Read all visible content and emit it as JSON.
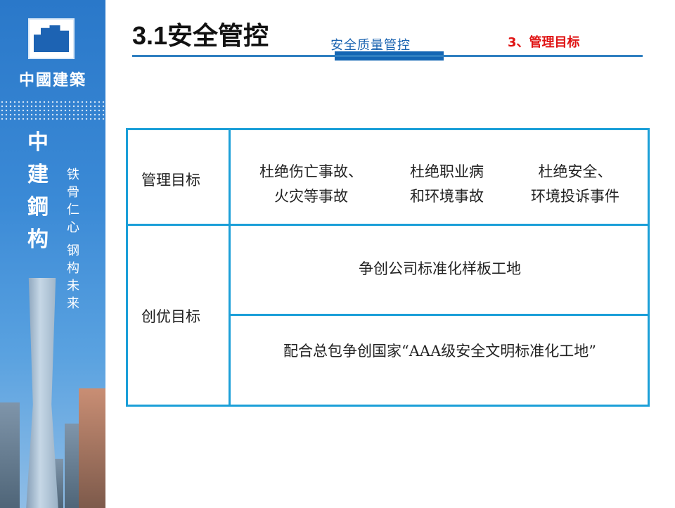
{
  "brand": {
    "company_name": "中國建築",
    "slogan_main": [
      "中",
      "建",
      "鋼",
      "构"
    ],
    "slogan_small": [
      "铁",
      "骨",
      "仁",
      "心",
      "钢",
      "构",
      "未",
      "来"
    ]
  },
  "header": {
    "title": "3.1安全管控",
    "section_tab": "安全质量管控",
    "subtitle": "3、管理目标"
  },
  "table": {
    "rows": [
      {
        "label": "管理目标",
        "goals": [
          {
            "line1": "杜绝伤亡事故、",
            "line2": "火灾等事故"
          },
          {
            "line1": "杜绝职业病",
            "line2": "和环境事故"
          },
          {
            "line1": "杜绝安全、",
            "line2": "环境投诉事件"
          }
        ]
      },
      {
        "label": "创优目标",
        "goals": [
          {
            "text": "争创公司标准化样板工地"
          },
          {
            "text": "配合总包争创国家“AAA级安全文明标准化工地”"
          }
        ]
      }
    ]
  },
  "colors": {
    "brand_blue": "#2a78c9",
    "table_border": "#1b9fd8",
    "subtitle_red": "#e01414",
    "tab_blue": "#1466b4"
  }
}
